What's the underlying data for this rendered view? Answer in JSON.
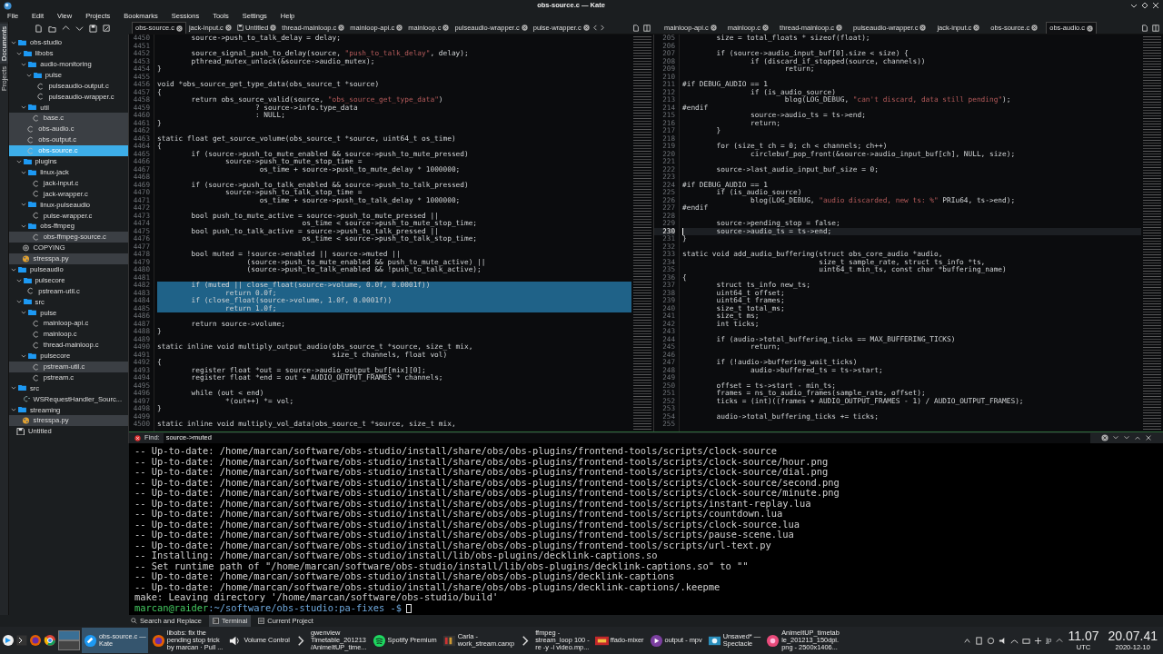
{
  "window": {
    "title": "obs-source.c — Kate"
  },
  "menu": [
    "File",
    "Edit",
    "View",
    "Projects",
    "Bookmarks",
    "Sessions",
    "Tools",
    "Settings",
    "Help"
  ],
  "sidebar_tabs": [
    {
      "label": "Documents",
      "selected": true
    },
    {
      "label": "Projects",
      "selected": false
    }
  ],
  "tree": [
    {
      "label": "obs-studio",
      "kind": "folder",
      "expanded": true,
      "children": [
        {
          "label": "libobs",
          "kind": "folder",
          "expanded": true,
          "children": [
            {
              "label": "audio-monitoring",
              "kind": "folder",
              "expanded": true,
              "children": [
                {
                  "label": "pulse",
                  "kind": "folder",
                  "expanded": true,
                  "children": [
                    {
                      "label": "pulseaudio-output.c",
                      "kind": "c",
                      "selected": false,
                      "shaded": false
                    },
                    {
                      "label": "pulseaudio-wrapper.c",
                      "kind": "c",
                      "selected": false,
                      "shaded": false
                    }
                  ]
                }
              ]
            },
            {
              "label": "util",
              "kind": "folder",
              "expanded": true,
              "children": [
                {
                  "label": "base.c",
                  "kind": "c",
                  "selected": false,
                  "shaded": true
                }
              ]
            },
            {
              "label": "obs-audio.c",
              "kind": "c",
              "selected": false,
              "shaded": true
            },
            {
              "label": "obs-output.c",
              "kind": "c",
              "selected": false,
              "shaded": true
            },
            {
              "label": "obs-source.c",
              "kind": "c",
              "selected": true,
              "shaded": false
            }
          ]
        },
        {
          "label": "plugins",
          "kind": "folder",
          "expanded": true,
          "children": [
            {
              "label": "linux-jack",
              "kind": "folder",
              "expanded": true,
              "children": [
                {
                  "label": "jack-input.c",
                  "kind": "c",
                  "selected": false,
                  "shaded": false
                },
                {
                  "label": "jack-wrapper.c",
                  "kind": "c",
                  "selected": false,
                  "shaded": false
                }
              ]
            },
            {
              "label": "linux-pulseaudio",
              "kind": "folder",
              "expanded": true,
              "children": [
                {
                  "label": "pulse-wrapper.c",
                  "kind": "c",
                  "selected": false,
                  "shaded": false
                }
              ]
            },
            {
              "label": "obs-ffmpeg",
              "kind": "folder",
              "expanded": true,
              "children": [
                {
                  "label": "obs-ffmpeg-source.c",
                  "kind": "c",
                  "selected": false,
                  "shaded": true
                }
              ]
            }
          ]
        },
        {
          "label": "COPYING",
          "kind": "text",
          "selected": false,
          "shaded": false
        },
        {
          "label": "stresspa.py",
          "kind": "python",
          "selected": false,
          "shaded": true
        }
      ]
    },
    {
      "label": "pulseaudio",
      "kind": "folder",
      "expanded": true,
      "children": [
        {
          "label": "pulsecore",
          "kind": "folder",
          "expanded": true,
          "children": [
            {
              "label": "pstream-util.c",
              "kind": "c",
              "selected": false,
              "shaded": false
            }
          ]
        },
        {
          "label": "src",
          "kind": "folder",
          "expanded": true,
          "children": [
            {
              "label": "pulse",
              "kind": "folder",
              "expanded": true,
              "children": [
                {
                  "label": "mainloop-api.c",
                  "kind": "c",
                  "selected": false,
                  "shaded": false
                },
                {
                  "label": "mainloop.c",
                  "kind": "c",
                  "selected": false,
                  "shaded": false
                },
                {
                  "label": "thread-mainloop.c",
                  "kind": "c",
                  "selected": false,
                  "shaded": false
                }
              ]
            },
            {
              "label": "pulsecore",
              "kind": "folder",
              "expanded": true,
              "children": [
                {
                  "label": "pstream-util.c",
                  "kind": "c",
                  "selected": false,
                  "shaded": true
                },
                {
                  "label": "pstream.c",
                  "kind": "c",
                  "selected": false,
                  "shaded": false
                }
              ]
            }
          ]
        }
      ]
    },
    {
      "label": "src",
      "kind": "folder",
      "expanded": true,
      "children": [
        {
          "label": "WSRequestHandler_Sourc...",
          "kind": "cpp",
          "selected": false,
          "shaded": false
        }
      ]
    },
    {
      "label": "streaming",
      "kind": "folder",
      "expanded": true,
      "children": [
        {
          "label": "stresspa.py",
          "kind": "python",
          "selected": false,
          "shaded": true
        }
      ]
    },
    {
      "label": "Untitled",
      "kind": "untitled",
      "selected": false,
      "shaded": false
    }
  ],
  "editors": [
    {
      "tabs": [
        {
          "label": "obs-source.c",
          "kind": "file",
          "selected": true
        },
        {
          "label": "jack-input.c",
          "kind": "file",
          "selected": false
        },
        {
          "label": "Untitled",
          "kind": "unsaved",
          "selected": false
        },
        {
          "label": "thread-mainloop.c",
          "kind": "file",
          "selected": false
        },
        {
          "label": "mainloop-api.c",
          "kind": "file",
          "selected": false
        },
        {
          "label": "mainloop.c",
          "kind": "file",
          "selected": false
        },
        {
          "label": "pulseaudio-wrapper.c",
          "kind": "file",
          "selected": false
        },
        {
          "label": "pulse-wrapper.c",
          "kind": "file",
          "selected": false
        }
      ],
      "lines": [
        {
          "n": "4450",
          "text": "\tsource->push_to_talk_delay = delay;"
        },
        {
          "n": "4451"
        },
        {
          "n": "4452",
          "text": "\tsource_signal_push_to_delay(source, \"push_to_talk_delay\", delay);"
        },
        {
          "n": "4453",
          "text": "\tpthread_mutex_unlock(&source->audio_mutex);"
        },
        {
          "n": "4454",
          "text": "}"
        },
        {
          "n": "4455"
        },
        {
          "n": "4456",
          "text": "void *obs_source_get_type_data(obs_source_t *source)"
        },
        {
          "n": "4457",
          "text": "{"
        },
        {
          "n": "4458",
          "text": "\treturn obs_source_valid(source, \"obs_source_get_type_data\")"
        },
        {
          "n": "4459",
          "text": "\t\t       ? source->info.type_data"
        },
        {
          "n": "4460",
          "text": "\t\t       : NULL;"
        },
        {
          "n": "4461",
          "text": "}"
        },
        {
          "n": "4462"
        },
        {
          "n": "4463",
          "text": "static float get_source_volume(obs_source_t *source, uint64_t os_time)"
        },
        {
          "n": "4464",
          "text": "{"
        },
        {
          "n": "4465",
          "text": "\tif (source->push_to_mute_enabled && source->push_to_mute_pressed)"
        },
        {
          "n": "4466",
          "text": "\t\tsource->push_to_mute_stop_time ="
        },
        {
          "n": "4467",
          "text": "\t\t\tos_time + source->push_to_mute_delay * 1000000;"
        },
        {
          "n": "4468"
        },
        {
          "n": "4469",
          "text": "\tif (source->push_to_talk_enabled && source->push_to_talk_pressed)"
        },
        {
          "n": "4470",
          "text": "\t\tsource->push_to_talk_stop_time ="
        },
        {
          "n": "4471",
          "text": "\t\t\tos_time + source->push_to_talk_delay * 1000000;"
        },
        {
          "n": "4472"
        },
        {
          "n": "4473",
          "text": "\tbool push_to_mute_active = source->push_to_mute_pressed ||"
        },
        {
          "n": "4474",
          "text": "\t\t\t\t  os_time < source->push_to_mute_stop_time;"
        },
        {
          "n": "4475",
          "text": "\tbool push_to_talk_active = source->push_to_talk_pressed ||"
        },
        {
          "n": "4476",
          "text": "\t\t\t\t  os_time < source->push_to_talk_stop_time;"
        },
        {
          "n": "4477"
        },
        {
          "n": "4478",
          "text": "\tbool muted = !source->enabled || source->muted ||"
        },
        {
          "n": "4479",
          "text": "\t\t     (source->push_to_mute_enabled && push_to_mute_active) ||"
        },
        {
          "n": "4480",
          "text": "\t\t     (source->push_to_talk_enabled && !push_to_talk_active);"
        },
        {
          "n": "4481"
        },
        {
          "n": "4482",
          "text": "\tif (muted || close_float(source->volume, 0.0f, 0.0001f))",
          "selected": true
        },
        {
          "n": "4483",
          "text": "\t\treturn 0.0f;",
          "selected": true
        },
        {
          "n": "4484",
          "text": "\tif (close_float(source->volume, 1.0f, 0.0001f))",
          "selected": true
        },
        {
          "n": "4485",
          "text": "\t\treturn 1.0f;",
          "selected": true
        },
        {
          "n": "4486"
        },
        {
          "n": "4487",
          "text": "\treturn source->volume;"
        },
        {
          "n": "4488",
          "text": "}"
        },
        {
          "n": "4489"
        },
        {
          "n": "4490",
          "text": "static inline void multiply_output_audio(obs_source_t *source, size_t mix,"
        },
        {
          "n": "4491",
          "text": "\t\t\t\t\t size_t channels, float vol)"
        },
        {
          "n": "4492",
          "text": "{"
        },
        {
          "n": "4493",
          "text": "\tregister float *out = source->audio_output_buf[mix][0];"
        },
        {
          "n": "4494",
          "text": "\tregister float *end = out + AUDIO_OUTPUT_FRAMES * channels;"
        },
        {
          "n": "4495"
        },
        {
          "n": "4496",
          "text": "\twhile (out < end)"
        },
        {
          "n": "4497",
          "text": "\t\t*(out++) *= vol;"
        },
        {
          "n": "4498",
          "text": "}"
        },
        {
          "n": "4499"
        },
        {
          "n": "4500",
          "text": "static inline void multiply_vol_data(obs_source_t *source, size_t mix,"
        }
      ]
    },
    {
      "tabs": [
        {
          "label": "mainloop-api.c",
          "kind": "file",
          "selected": false
        },
        {
          "label": "mainloop.c",
          "kind": "file",
          "selected": false
        },
        {
          "label": "thread-mainloop.c",
          "kind": "file",
          "selected": false
        },
        {
          "label": "pulseaudio-wrapper.c",
          "kind": "file",
          "selected": false
        },
        {
          "label": "jack-input.c",
          "kind": "file",
          "selected": false
        },
        {
          "label": "obs-source.c",
          "kind": "file",
          "selected": false
        },
        {
          "label": "obs-audio.c",
          "kind": "file",
          "selected": true
        }
      ],
      "lines": [
        {
          "n": "205",
          "text": "\tsize = total_floats * sizeof(float);"
        },
        {
          "n": "206"
        },
        {
          "n": "207",
          "text": "\tif (source->audio_input_buf[0].size < size) {"
        },
        {
          "n": "208",
          "text": "\t\tif (discard_if_stopped(source, channels))"
        },
        {
          "n": "209",
          "text": "\t\t\treturn;"
        },
        {
          "n": "210"
        },
        {
          "n": "211",
          "text": "#if DEBUG_AUDIO == 1"
        },
        {
          "n": "212",
          "text": "\t\tif (is_audio_source)"
        },
        {
          "n": "213",
          "text": "\t\t\tblog(LOG_DEBUG, \"can't discard, data still pending\");"
        },
        {
          "n": "214",
          "text": "#endif"
        },
        {
          "n": "215",
          "text": "\t\tsource->audio_ts = ts->end;"
        },
        {
          "n": "216",
          "text": "\t\treturn;"
        },
        {
          "n": "217",
          "text": "\t}"
        },
        {
          "n": "218"
        },
        {
          "n": "219",
          "text": "\tfor (size_t ch = 0; ch < channels; ch++)"
        },
        {
          "n": "220",
          "text": "\t\tcirclebuf_pop_front(&source->audio_input_buf[ch], NULL, size);"
        },
        {
          "n": "221"
        },
        {
          "n": "222",
          "text": "\tsource->last_audio_input_buf_size = 0;"
        },
        {
          "n": "223"
        },
        {
          "n": "224",
          "text": "#if DEBUG_AUDIO == 1"
        },
        {
          "n": "225",
          "text": "\tif (is_audio_source)"
        },
        {
          "n": "226",
          "text": "\t\tblog(LOG_DEBUG, \"audio discarded, new ts: %\" PRIu64, ts->end);"
        },
        {
          "n": "227",
          "text": "#endif"
        },
        {
          "n": "228"
        },
        {
          "n": "229",
          "text": "\tsource->pending_stop = false;"
        },
        {
          "n": "230",
          "text": "\tsource->audio_ts = ts->end;",
          "current": true
        },
        {
          "n": "231",
          "text": "}"
        },
        {
          "n": "232"
        },
        {
          "n": "233",
          "text": "static void add_audio_buffering(struct obs_core_audio *audio,"
        },
        {
          "n": "234",
          "text": "\t\t\t\tsize_t sample_rate, struct ts_info *ts,"
        },
        {
          "n": "235",
          "text": "\t\t\t\tuint64_t min_ts, const char *buffering_name)"
        },
        {
          "n": "236",
          "text": "{"
        },
        {
          "n": "237",
          "text": "\tstruct ts_info new_ts;"
        },
        {
          "n": "238",
          "text": "\tuint64_t offset;"
        },
        {
          "n": "239",
          "text": "\tuint64_t frames;"
        },
        {
          "n": "240",
          "text": "\tsize_t total_ms;"
        },
        {
          "n": "241",
          "text": "\tsize_t ms;"
        },
        {
          "n": "242",
          "text": "\tint ticks;"
        },
        {
          "n": "243"
        },
        {
          "n": "244",
          "text": "\tif (audio->total_buffering_ticks == MAX_BUFFERING_TICKS)"
        },
        {
          "n": "245",
          "text": "\t\treturn;"
        },
        {
          "n": "246"
        },
        {
          "n": "247",
          "text": "\tif (!audio->buffering_wait_ticks)"
        },
        {
          "n": "248",
          "text": "\t\taudio->buffered_ts = ts->start;"
        },
        {
          "n": "249"
        },
        {
          "n": "250",
          "text": "\toffset = ts->start - min_ts;"
        },
        {
          "n": "251",
          "text": "\tframes = ns_to_audio_frames(sample_rate, offset);"
        },
        {
          "n": "252",
          "text": "\tticks = (int)((frames + AUDIO_OUTPUT_FRAMES - 1) / AUDIO_OUTPUT_FRAMES);"
        },
        {
          "n": "253"
        },
        {
          "n": "254",
          "text": "\taudio->total_buffering_ticks += ticks;"
        },
        {
          "n": "255"
        }
      ]
    }
  ],
  "find_bar": {
    "label": "Find:",
    "value": "source->muted"
  },
  "terminal": {
    "lines": [
      "-- Up-to-date: /home/marcan/software/obs-studio/install/share/obs/obs-plugins/frontend-tools/scripts/clock-source",
      "-- Up-to-date: /home/marcan/software/obs-studio/install/share/obs/obs-plugins/frontend-tools/scripts/clock-source/hour.png",
      "-- Up-to-date: /home/marcan/software/obs-studio/install/share/obs/obs-plugins/frontend-tools/scripts/clock-source/dial.png",
      "-- Up-to-date: /home/marcan/software/obs-studio/install/share/obs/obs-plugins/frontend-tools/scripts/clock-source/second.png",
      "-- Up-to-date: /home/marcan/software/obs-studio/install/share/obs/obs-plugins/frontend-tools/scripts/clock-source/minute.png",
      "-- Up-to-date: /home/marcan/software/obs-studio/install/share/obs/obs-plugins/frontend-tools/scripts/instant-replay.lua",
      "-- Up-to-date: /home/marcan/software/obs-studio/install/share/obs/obs-plugins/frontend-tools/scripts/countdown.lua",
      "-- Up-to-date: /home/marcan/software/obs-studio/install/share/obs/obs-plugins/frontend-tools/scripts/clock-source.lua",
      "-- Up-to-date: /home/marcan/software/obs-studio/install/share/obs/obs-plugins/frontend-tools/scripts/pause-scene.lua",
      "-- Up-to-date: /home/marcan/software/obs-studio/install/share/obs/obs-plugins/frontend-tools/scripts/url-text.py",
      "-- Installing: /home/marcan/software/obs-studio/install/lib/obs-plugins/decklink-captions.so",
      "-- Set runtime path of \"/home/marcan/software/obs-studio/install/lib/obs-plugins/decklink-captions.so\" to \"\"",
      "-- Up-to-date: /home/marcan/software/obs-studio/install/share/obs/obs-plugins/decklink-captions",
      "-- Up-to-date: /home/marcan/software/obs-studio/install/share/obs/obs-plugins/decklink-captions/.keepme",
      "make: Leaving directory '/home/marcan/software/obs-studio/build'"
    ],
    "prompt": {
      "host": "marcan@raider",
      "path": ":~/software/obs-studio:pa-fixes -$"
    }
  },
  "tool_tabs": [
    {
      "label": "Search and Replace",
      "kind": "search",
      "selected": false
    },
    {
      "label": "Terminal",
      "kind": "terminal",
      "selected": true
    },
    {
      "label": "Current Project",
      "kind": "project",
      "selected": false
    }
  ],
  "taskbar": {
    "tasks": [
      {
        "kind": "kate",
        "lines": [
          "obs-source.c —",
          "Kate"
        ],
        "selected": true
      },
      {
        "kind": "firefox",
        "lines": [
          "libobs: fix the",
          "pending stop trick",
          "by marcan · Pull ..."
        ],
        "selected": false
      },
      {
        "kind": "speaker",
        "lines": [
          "Volume Control"
        ],
        "selected": false
      },
      {
        "kind": "terminal",
        "lines": [
          "gwenview",
          "Timetable_201213",
          "/AnimeItUP_time..."
        ],
        "selected": false
      },
      {
        "kind": "spotify",
        "lines": [
          "Spotify Premium"
        ],
        "selected": false
      },
      {
        "kind": "carla",
        "lines": [
          "Carla -",
          "work_stream.carxp"
        ],
        "selected": false
      },
      {
        "kind": "terminal",
        "lines": [
          "ffmpeg -",
          "stream_loop 100 -",
          "re -y -i video.mp..."
        ],
        "selected": false
      },
      {
        "kind": "ffado",
        "lines": [
          "ffado-mixer"
        ],
        "selected": false
      },
      {
        "kind": "mpv",
        "lines": [
          "output - mpv"
        ],
        "selected": false
      },
      {
        "kind": "spectacle",
        "lines": [
          "Unsaved* —",
          "Spectacle"
        ],
        "selected": false
      },
      {
        "kind": "image",
        "lines": [
          "AnimeItUP_timetab",
          "le_201213_150dpi.",
          "png - 2500x1406..."
        ],
        "selected": false
      }
    ],
    "keyboard_layout": "jp",
    "clocks": [
      {
        "time": "11.07",
        "label": "UTC"
      },
      {
        "time": "20.07.41",
        "label": "2020-12-10"
      }
    ]
  }
}
